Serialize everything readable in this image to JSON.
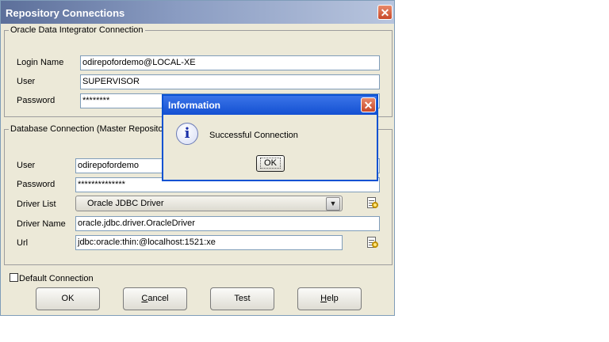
{
  "window": {
    "title": "Repository Connections",
    "odi_group": {
      "legend": "Oracle Data Integrator Connection",
      "login_name_label": "Login Name",
      "login_name_value": "odirepofordemo@LOCAL-XE",
      "user_label": "User",
      "user_value": "SUPERVISOR",
      "password_label": "Password",
      "password_value": "********"
    },
    "db_group": {
      "legend": "Database Connection (Master Repositor",
      "user_label": "User",
      "user_value": "odirepofordemo",
      "password_label": "Password",
      "password_value": "**************",
      "driver_list_label": "Driver List",
      "driver_list_value": "Oracle JDBC Driver",
      "driver_name_label": "Driver Name",
      "driver_name_value": "oracle.jdbc.driver.OracleDriver",
      "url_label": "Url",
      "url_value": "jdbc:oracle:thin:@localhost:1521:xe"
    },
    "default_connection_label": "Default Connection",
    "buttons": {
      "ok": "OK",
      "cancel_pre": "",
      "cancel_u": "C",
      "cancel_post": "ancel",
      "test": "Test",
      "help_u": "H",
      "help_post": "elp"
    }
  },
  "dialog": {
    "title": "Information",
    "message": "Successful Connection",
    "ok": "OK"
  },
  "colors": {
    "dialog_border": "#0a52d2",
    "window_bg": "#ece9d8"
  }
}
